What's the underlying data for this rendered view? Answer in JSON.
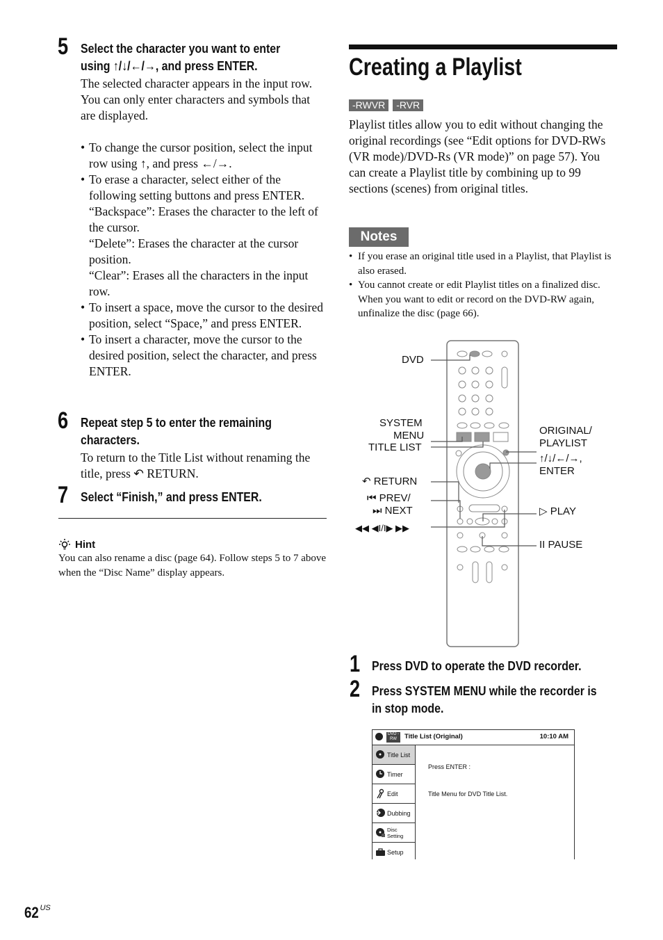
{
  "left": {
    "step5": {
      "num": "5",
      "head1": "Select the character you want to enter",
      "head2": "using ↑/↓/←/→, and press ENTER.",
      "p1": "The selected character appears in the input row.",
      "p2": "You can only enter characters and symbols that are displayed.",
      "bullets": [
        "To change the cursor position, select the input row using ↑, and press ←/→.",
        "To erase a character, select either of the following setting buttons and press ENTER.",
        "“Backspace”: Erases the character to the left of the cursor.",
        "“Delete”: Erases the character at the cursor position.",
        "“Clear”: Erases all the characters in the input row.",
        "To insert a space, move the cursor to the desired position, select “Space,” and press ENTER.",
        "To insert a character, move the cursor to the desired position, select the character, and press ENTER."
      ]
    },
    "step6": {
      "num": "6",
      "head1": "Repeat step 5 to enter the remaining",
      "head2": "characters.",
      "p1": "To return to the Title List without renaming the title, press ↶ RETURN."
    },
    "step7": {
      "num": "7",
      "head": "Select “Finish,” and press ENTER."
    },
    "hint": {
      "title": "Hint",
      "text": "You can also rename a disc (page 64). Follow steps 5 to 7 above when the “Disc Name” display appears."
    }
  },
  "right": {
    "title": "Creating a Playlist",
    "badges": [
      "-RWVR",
      "-RVR"
    ],
    "intro": "Playlist titles allow you to edit without changing the original recordings (see “Edit options for DVD-RWs (VR mode)/DVD-Rs (VR mode)” on page 57). You can create a Playlist title by combining up to 99 sections (scenes) from original titles.",
    "notes_label": "Notes",
    "notes": [
      "If you erase an original title used in a Playlist, that Playlist is also erased.",
      "You cannot create or edit Playlist titles on a finalized disc. When you want to edit or record on the DVD-RW again, unfinalize the disc (page 66)."
    ],
    "remote_labels": {
      "dvd": "DVD",
      "system_menu_1": "SYSTEM",
      "system_menu_2": "MENU",
      "title_list": "TITLE LIST",
      "return": "↶ RETURN",
      "prev": "⏮ PREV/",
      "next": "⏭ NEXT",
      "slow": "◀◀ ◀I/I▶ ▶▶",
      "original_1": "ORIGINAL/",
      "original_2": "PLAYLIST",
      "arrows": "↑/↓/←/→,",
      "enter": "ENTER",
      "play": "▷ PLAY",
      "pause": "II PAUSE"
    },
    "step1": {
      "num": "1",
      "head": "Press DVD to operate the DVD recorder."
    },
    "step2": {
      "num": "2",
      "head1": "Press SYSTEM MENU while the recorder is",
      "head2": "in stop mode."
    },
    "osd": {
      "header_title": "Title List (Original)",
      "time": "10:10 AM",
      "disc_badge": "DVD -RW",
      "menu": [
        "Title List",
        "Timer",
        "Edit",
        "Dubbing",
        "Disc Setting",
        "Setup"
      ],
      "line1": "Press ENTER :",
      "line2": "Title Menu for DVD Title List."
    }
  },
  "footer": {
    "page": "62",
    "suffix": "US"
  }
}
